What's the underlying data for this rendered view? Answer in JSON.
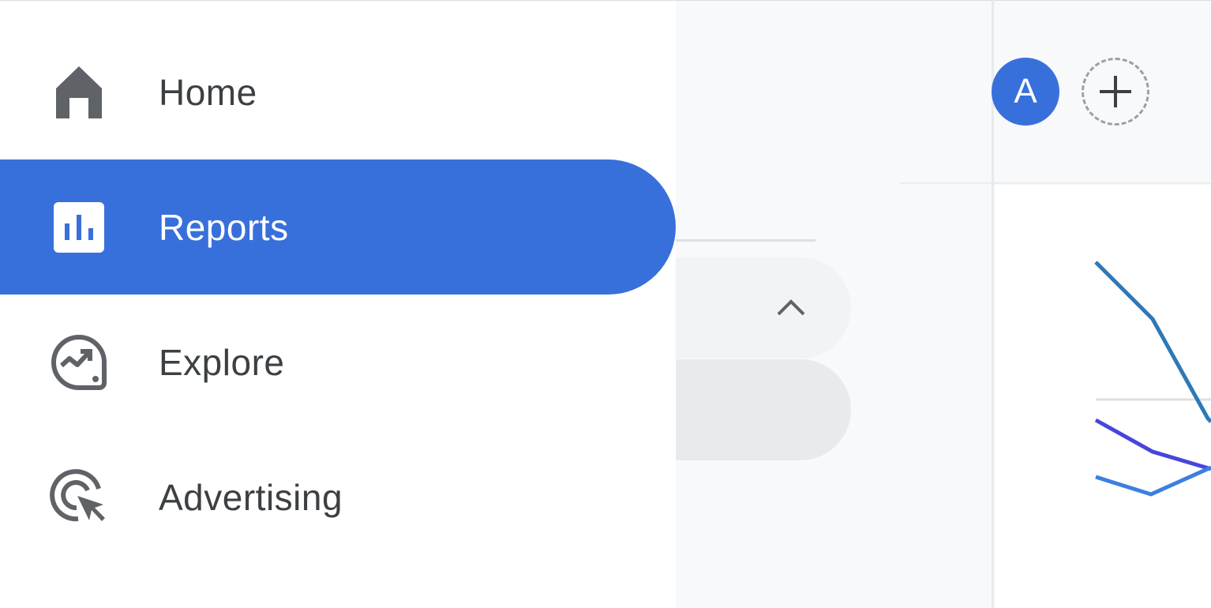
{
  "nav": {
    "items": [
      {
        "label": "Home",
        "icon": "home-icon",
        "active": false
      },
      {
        "label": "Reports",
        "icon": "bar-chart-icon",
        "active": true
      },
      {
        "label": "Explore",
        "icon": "explore-icon",
        "active": false
      },
      {
        "label": "Advertising",
        "icon": "advertising-icon",
        "active": false
      }
    ]
  },
  "header": {
    "avatar_initial": "A",
    "add_account_icon": "plus-icon"
  },
  "colors": {
    "accent": "#3870db",
    "nav_text": "#3c4043",
    "icon_gray": "#5f6368"
  }
}
